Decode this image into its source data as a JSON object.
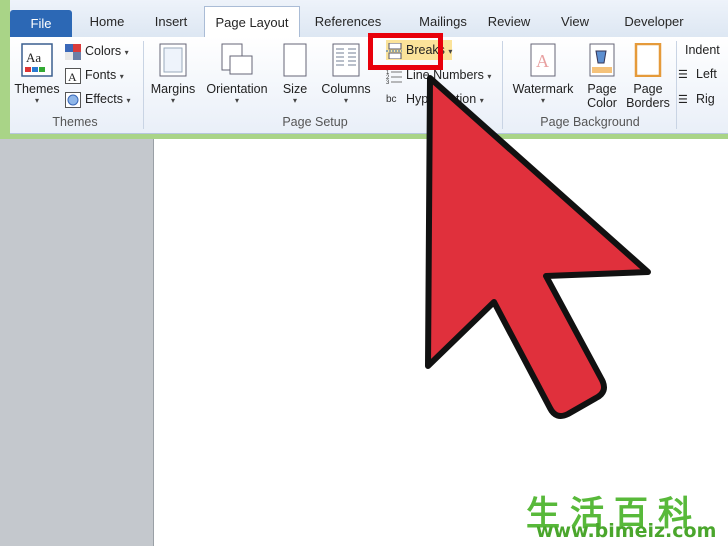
{
  "tabs": [
    "File",
    "Home",
    "Insert",
    "Page Layout",
    "References",
    "Mailings",
    "Review",
    "View",
    "Developer"
  ],
  "groups": {
    "themes": {
      "label": "Themes",
      "themes_btn": "Themes",
      "colors": "Colors",
      "fonts": "Fonts",
      "effects": "Effects",
      "themes_icon_text": "Aa"
    },
    "page_setup": {
      "label": "Page Setup",
      "margins": "Margins",
      "orientation": "Orientation",
      "size": "Size",
      "columns": "Columns",
      "breaks": "Breaks",
      "line_numbers": "Line Numbers",
      "hyphenation": "Hyphenation",
      "hyphen_icon": "bc"
    },
    "page_background": {
      "label": "Page Background",
      "watermark": "Watermark",
      "page_color_1": "Page",
      "page_color_2": "Color",
      "page_borders_1": "Page",
      "page_borders_2": "Borders"
    },
    "paragraph": {
      "indent": "Indent",
      "left": "Left",
      "right": "Rig"
    }
  },
  "colors": {
    "accent": "#2c68b5",
    "highlight_box": "#e8000b",
    "arrow": "#e0303c"
  },
  "watermark_brand": {
    "chars": "生活百科",
    "url": "www.bimeiz.com"
  }
}
